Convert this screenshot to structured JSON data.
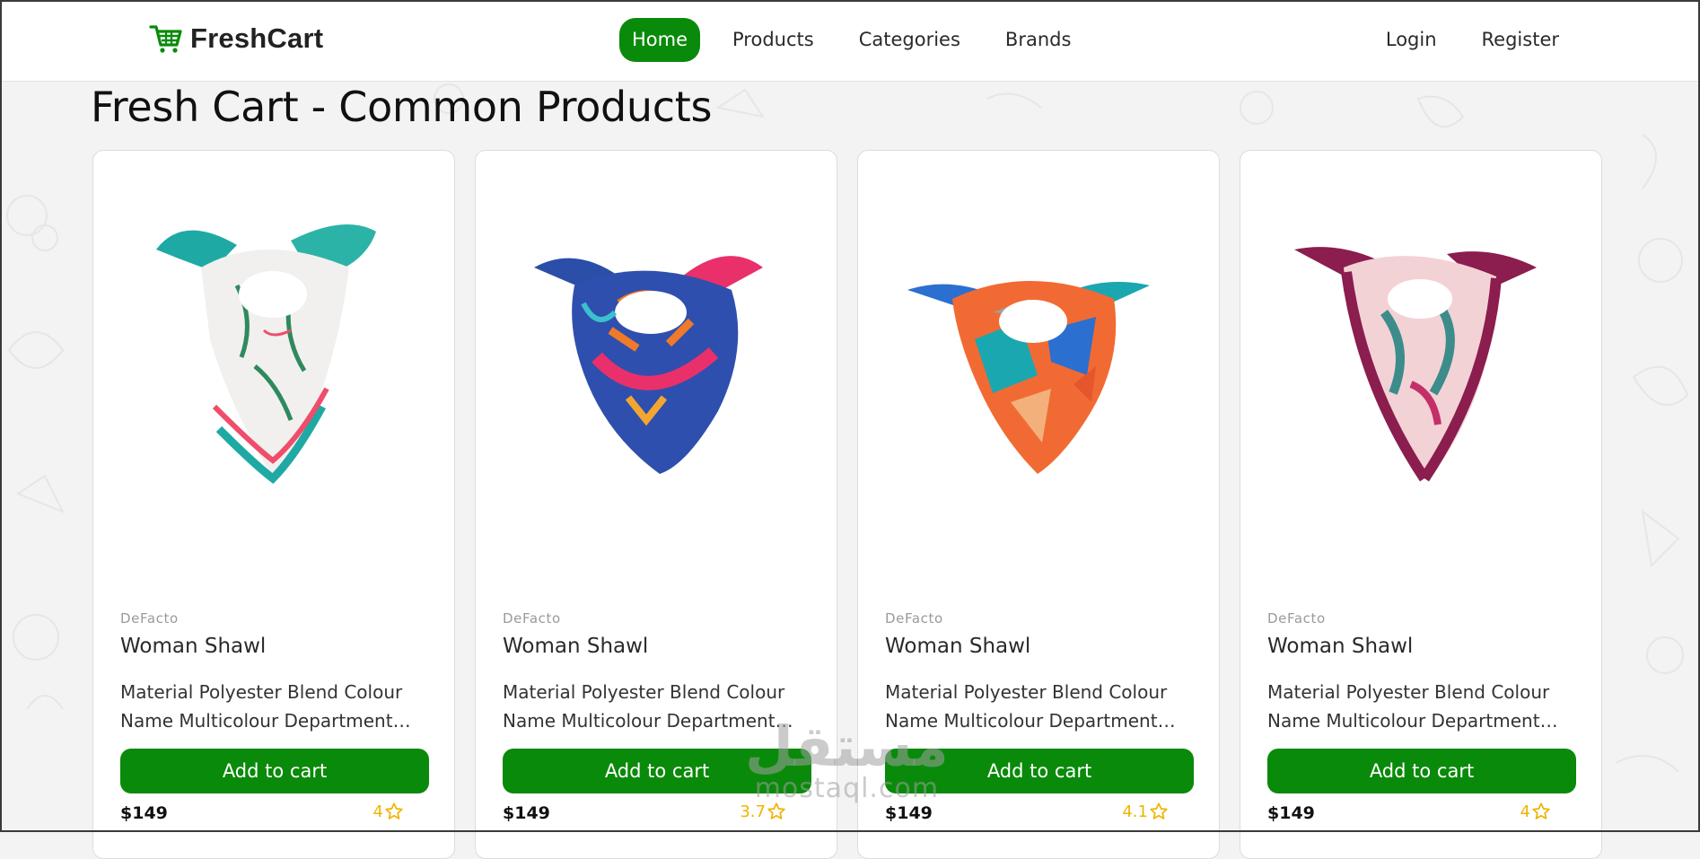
{
  "navbar": {
    "logo_text": "FreshCart",
    "links": [
      {
        "label": "Home",
        "active": true
      },
      {
        "label": "Products"
      },
      {
        "label": "Categories"
      },
      {
        "label": "Brands"
      }
    ],
    "auth": [
      {
        "label": "Login"
      },
      {
        "label": "Register"
      }
    ]
  },
  "page": {
    "title": "Fresh Cart - Common Products"
  },
  "products": [
    {
      "brand": "DeFacto",
      "name": "Woman Shawl",
      "description": "Material Polyester Blend Colour Name Multicolour Department Women",
      "button": "Add to cart",
      "price": "$149",
      "rating": "4"
    },
    {
      "brand": "DeFacto",
      "name": "Woman Shawl",
      "description": "Material Polyester Blend Colour Name Multicolour Department Women",
      "button": "Add to cart",
      "price": "$149",
      "rating": "3.7"
    },
    {
      "brand": "DeFacto",
      "name": "Woman Shawl",
      "description": "Material Polyester Blend Colour Name Multicolour Department Women",
      "button": "Add to cart",
      "price": "$149",
      "rating": "4.1"
    },
    {
      "brand": "DeFacto",
      "name": "Woman Shawl",
      "description": "Material Polyester Blend Colour Name Multicolour Department Women",
      "button": "Add to cart",
      "price": "$149",
      "rating": "4"
    }
  ],
  "icons": {
    "logo": "cart-icon",
    "rating": "star-outline-icon",
    "product_image": "scarf-image"
  },
  "watermark": {
    "arabic": "مستقل",
    "latin": "mostaql.com"
  },
  "colors": {
    "accent": "#0a8a0a",
    "rating": "#f0b400",
    "background": "#f3f3f3"
  }
}
